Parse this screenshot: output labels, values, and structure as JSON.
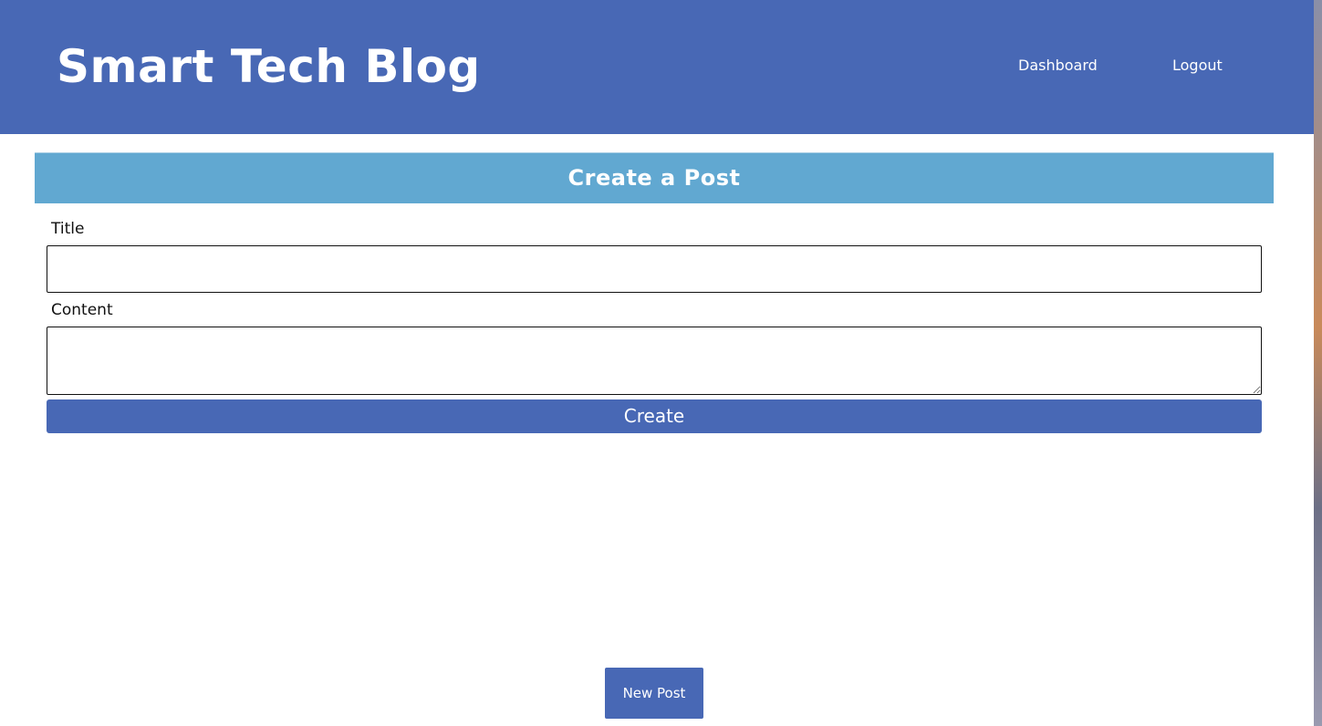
{
  "header": {
    "site_title": "Smart Tech Blog",
    "nav": {
      "dashboard_label": "Dashboard",
      "logout_label": "Logout"
    }
  },
  "form": {
    "heading": "Create a Post",
    "title_label": "Title",
    "title_value": "",
    "title_placeholder": "",
    "content_label": "Content",
    "content_value": "",
    "content_placeholder": "",
    "submit_label": "Create"
  },
  "footer": {
    "new_post_label": "New Post"
  },
  "colors": {
    "primary": "#4868b5",
    "card_header": "#61a8d1",
    "background": "#ffffff"
  }
}
